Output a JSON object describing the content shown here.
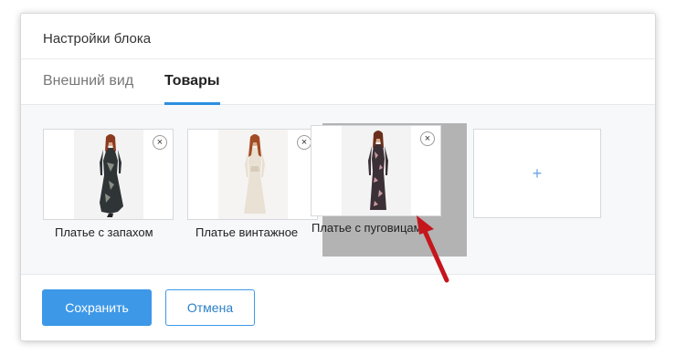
{
  "dialog": {
    "title": "Настройки блока"
  },
  "tabs": [
    {
      "label": "Внешний вид",
      "active": false
    },
    {
      "label": "Товары",
      "active": true
    }
  ],
  "products": [
    {
      "label": "Платье с запахом",
      "remove_icon": "×"
    },
    {
      "label": "Платье винтажное",
      "remove_icon": "×"
    },
    {
      "label": "Платье с пуговицами",
      "remove_icon": "×",
      "state": "dragging"
    }
  ],
  "add_tile": {
    "icon": "+"
  },
  "buttons": {
    "save": "Сохранить",
    "cancel": "Отмена"
  },
  "colors": {
    "accent": "#3d98e8",
    "annotation_arrow": "#c4161c"
  }
}
